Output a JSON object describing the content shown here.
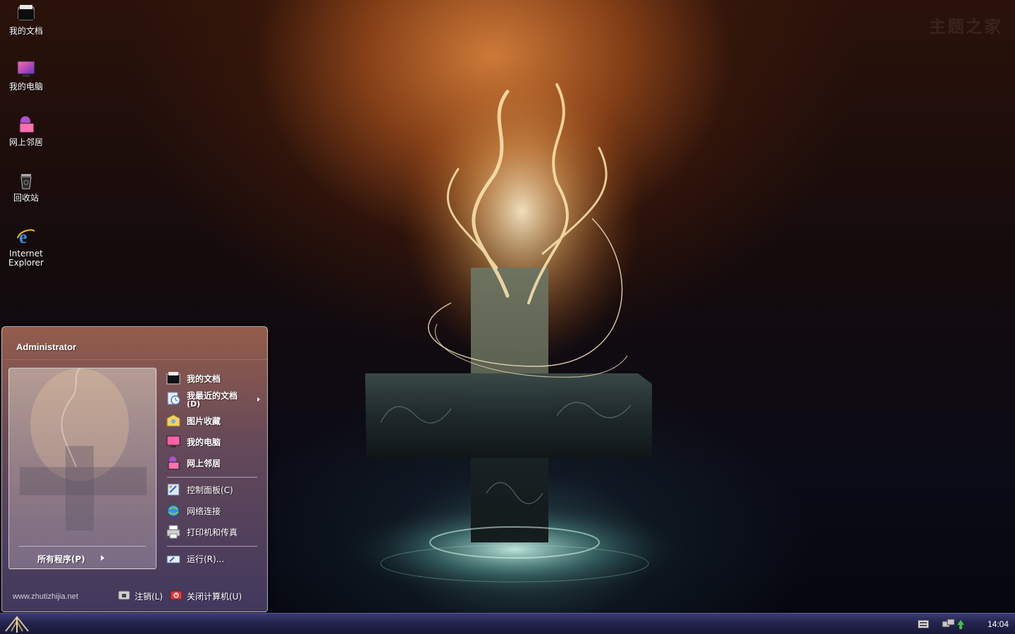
{
  "desktop": {
    "watermark": "主题之家",
    "icons": [
      {
        "label": "我的文档",
        "icon": "my-documents-icon"
      },
      {
        "label": "我的电脑",
        "icon": "my-computer-icon"
      },
      {
        "label": "网上邻居",
        "icon": "network-places-icon"
      },
      {
        "label": "回收站",
        "icon": "recycle-bin-icon"
      },
      {
        "label": "Internet Explorer",
        "icon": "internet-explorer-icon"
      }
    ]
  },
  "start_menu": {
    "user": "Administrator",
    "all_programs": "所有程序(P)",
    "right_items": [
      {
        "label": "我的文档",
        "icon": "my-documents-icon"
      },
      {
        "label": "我最近的文档",
        "sub": "(D)",
        "icon": "recent-documents-icon"
      },
      {
        "label": "图片收藏",
        "icon": "my-pictures-icon"
      },
      {
        "label": "我的电脑",
        "icon": "my-computer-icon"
      },
      {
        "label": "网上邻居",
        "icon": "network-places-icon"
      },
      {
        "label": "控制面板(C)",
        "icon": "control-panel-icon"
      },
      {
        "label": "网络连接",
        "icon": "network-connections-icon"
      },
      {
        "label": "打印机和传真",
        "icon": "printers-faxes-icon"
      },
      {
        "label": "运行(R)...",
        "icon": "run-icon"
      }
    ],
    "footer": {
      "website": "www.zhutizhijia.net",
      "logoff": "注销(L)",
      "shutdown": "关闭计算机(U)"
    }
  },
  "taskbar": {
    "clock": "14:04"
  },
  "colors": {
    "accent_orange": "#c8782f",
    "taskbar_blue": "#23234d",
    "shutdown_red": "#d83a3a"
  }
}
